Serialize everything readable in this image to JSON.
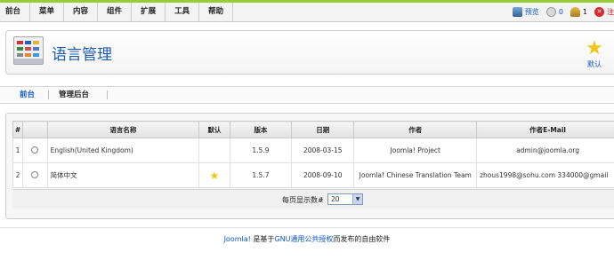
{
  "menu": [
    "前台",
    "菜单",
    "内容",
    "组件",
    "扩展",
    "工具",
    "帮助"
  ],
  "status": {
    "preview": "预览",
    "messages": "0",
    "users": "1",
    "logout": "注"
  },
  "toolbar": {
    "title": "语言管理",
    "default_label": "默认"
  },
  "tabs": [
    "前台",
    "管理后台"
  ],
  "table": {
    "headers": [
      "#",
      "",
      "语言名称",
      "默认",
      "版本",
      "日期",
      "作者",
      "作者E-Mail"
    ],
    "rows": [
      {
        "num": "1",
        "name": "English(United Kingdom)",
        "default": false,
        "version": "1.5.9",
        "date": "2008-03-15",
        "author": "Joomla! Project",
        "email": "admin@joomla.org"
      },
      {
        "num": "2",
        "name": "简体中文",
        "default": true,
        "version": "1.5.7",
        "date": "2008-09-10",
        "author": "Joomla! Chinese Translation Team",
        "email": "zhous1998@sohu.com 334000@gmail"
      }
    ]
  },
  "pager": {
    "label": "每页显示数#",
    "value": "20"
  },
  "credit": {
    "brand": "Joomla!",
    "text1": " 是基于",
    "link": "GNU通用公共授权",
    "text2": "而发布的自由软件"
  }
}
